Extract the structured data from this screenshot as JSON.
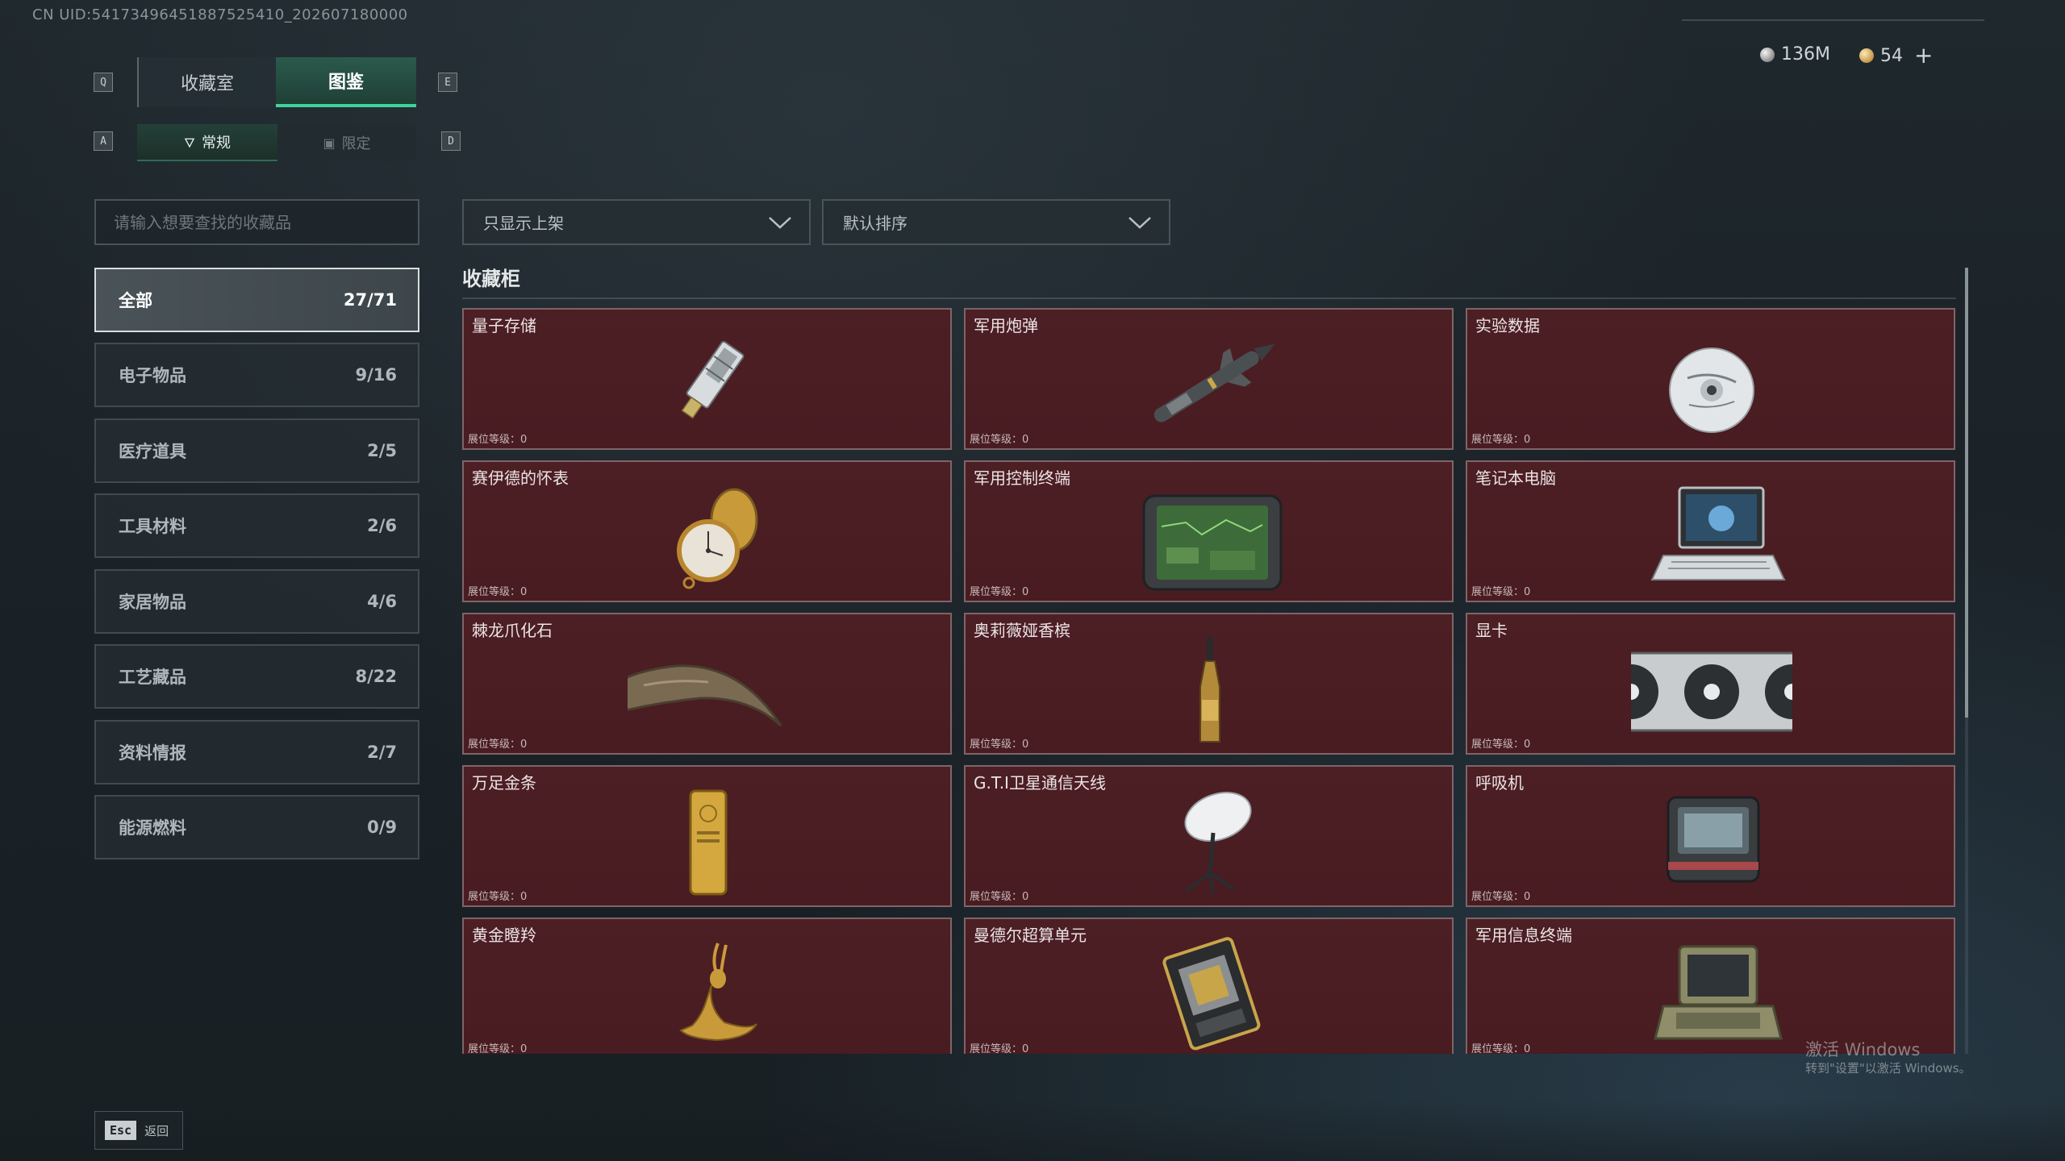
{
  "uid": "CN UID:54173496451887525410_202607180000",
  "currency": [
    {
      "icon": "silver-coin-icon",
      "value": "136M"
    },
    {
      "icon": "gold-coin-icon",
      "value": "54"
    }
  ],
  "currency_plus": "+",
  "keys": {
    "q": "Q",
    "e": "E",
    "a": "A",
    "d": "D"
  },
  "tabs": {
    "collection_room": "收藏室",
    "codex": "图鉴"
  },
  "subtabs": {
    "regular": "常规",
    "limited": "限定"
  },
  "search": {
    "placeholder": "请输入想要查找的收藏品",
    "value": ""
  },
  "filter_dropdown": {
    "selected": "只显示上架"
  },
  "sort_dropdown": {
    "selected": "默认排序"
  },
  "categories": [
    {
      "name": "全部",
      "count": "27/71"
    },
    {
      "name": "电子物品",
      "count": "9/16"
    },
    {
      "name": "医疗道具",
      "count": "2/5"
    },
    {
      "name": "工具材料",
      "count": "2/6"
    },
    {
      "name": "家居物品",
      "count": "4/6"
    },
    {
      "name": "工艺藏品",
      "count": "8/22"
    },
    {
      "name": "资料情报",
      "count": "2/7"
    },
    {
      "name": "能源燃料",
      "count": "0/9"
    }
  ],
  "section_title": "收藏柜",
  "level_text": "展位等级：0",
  "items": [
    {
      "name": "量子存储",
      "icon": "usb-drive-icon"
    },
    {
      "name": "军用炮弹",
      "icon": "missile-icon"
    },
    {
      "name": "实验数据",
      "icon": "disc-icon"
    },
    {
      "name": "赛伊德的怀表",
      "icon": "pocket-watch-icon"
    },
    {
      "name": "军用控制终端",
      "icon": "control-terminal-icon"
    },
    {
      "name": "笔记本电脑",
      "icon": "laptop-icon"
    },
    {
      "name": "棘龙爪化石",
      "icon": "claw-fossil-icon"
    },
    {
      "name": "奥莉薇娅香槟",
      "icon": "champagne-icon"
    },
    {
      "name": "显卡",
      "icon": "graphics-card-icon"
    },
    {
      "name": "万足金条",
      "icon": "gold-bar-icon"
    },
    {
      "name": "G.T.I卫星通信天线",
      "icon": "satellite-dish-icon"
    },
    {
      "name": "呼吸机",
      "icon": "ventilator-icon"
    },
    {
      "name": "黄金瞪羚",
      "icon": "golden-gazelle-icon"
    },
    {
      "name": "曼德尔超算单元",
      "icon": "computing-unit-icon"
    },
    {
      "name": "军用信息终端",
      "icon": "info-terminal-icon"
    }
  ],
  "esc": {
    "key": "Esc",
    "label": "返回"
  },
  "watermark": {
    "line1": "激活 Windows",
    "line2": "转到\"设置\"以激活 Windows。"
  }
}
